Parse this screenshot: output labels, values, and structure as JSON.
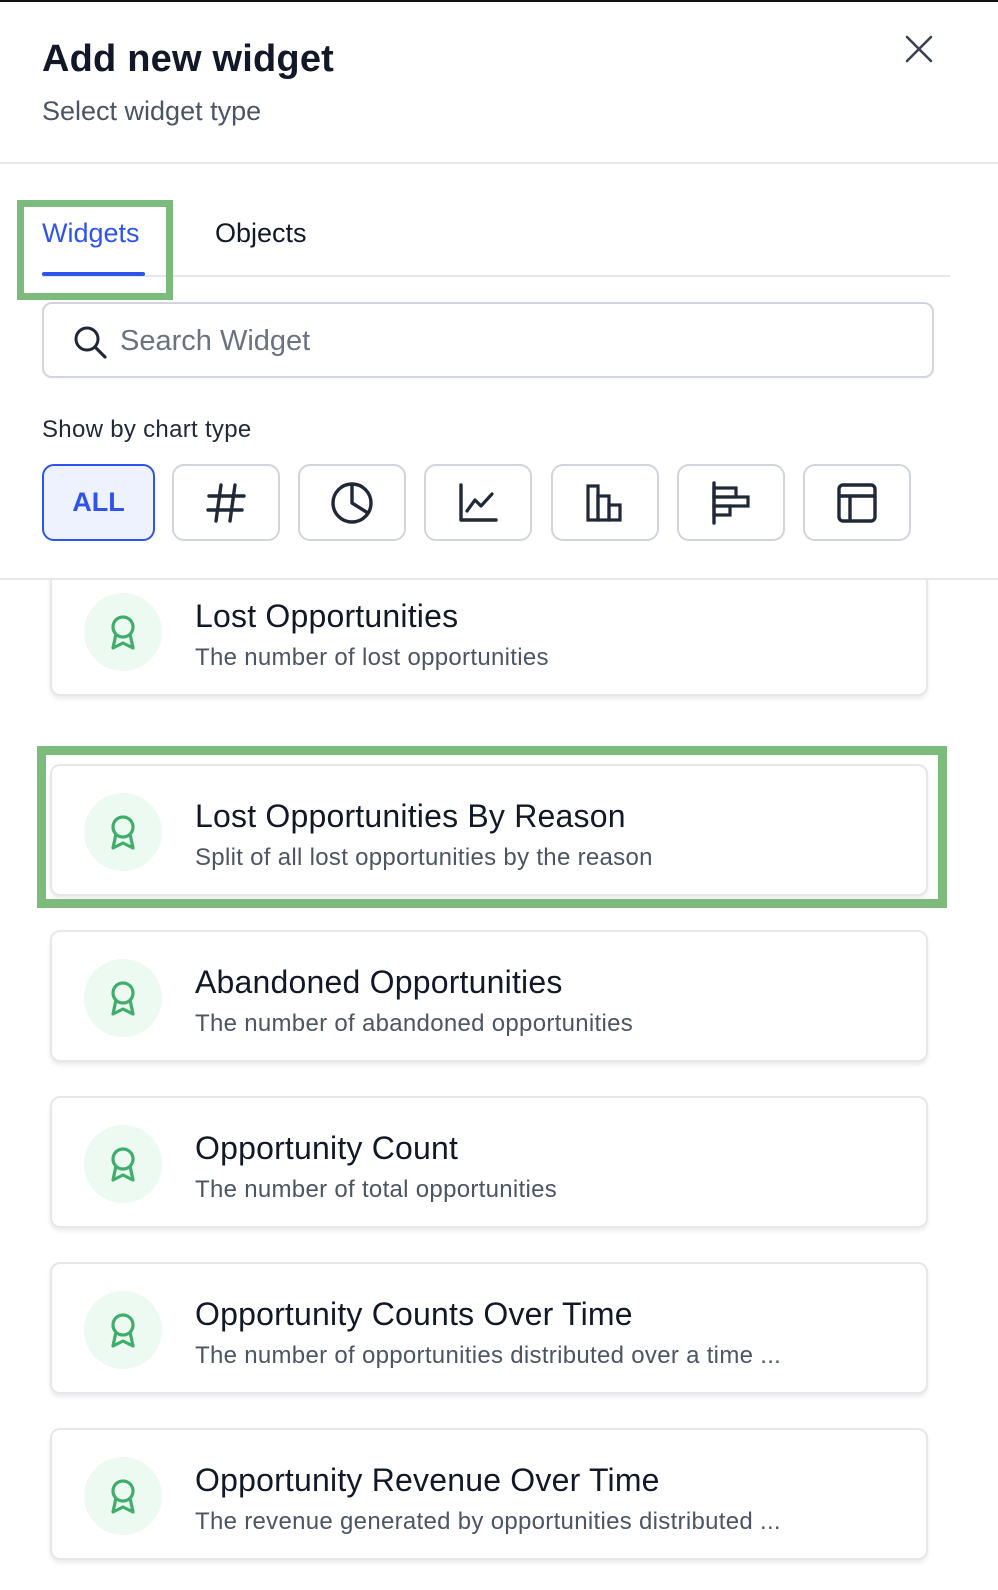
{
  "header": {
    "title": "Add new widget",
    "subtitle": "Select widget type",
    "close_icon": "close-icon"
  },
  "tabs": [
    {
      "label": "Widgets",
      "active": true
    },
    {
      "label": "Objects",
      "active": false
    }
  ],
  "search": {
    "placeholder": "Search Widget",
    "value": "",
    "icon": "search-icon"
  },
  "filter": {
    "label": "Show by chart type",
    "options": [
      {
        "label": "ALL",
        "icon": null,
        "active": true
      },
      {
        "icon": "hash-icon",
        "active": false
      },
      {
        "icon": "pie-chart-icon",
        "active": false
      },
      {
        "icon": "line-chart-icon",
        "active": false
      },
      {
        "icon": "bar-chart-icon",
        "active": false
      },
      {
        "icon": "horizontal-bar-chart-icon",
        "active": false
      },
      {
        "icon": "table-icon",
        "active": false
      }
    ]
  },
  "widgets": [
    {
      "title": "Lost Opportunities",
      "description": "The number of lost opportunities",
      "icon": "award-icon"
    },
    {
      "title": "Lost Opportunities By Reason",
      "description": "Split of all lost opportunities by the reason",
      "icon": "award-icon",
      "highlighted": true
    },
    {
      "title": "Abandoned Opportunities",
      "description": "The number of abandoned opportunities",
      "icon": "award-icon"
    },
    {
      "title": "Opportunity Count",
      "description": "The number of total opportunities",
      "icon": "award-icon"
    },
    {
      "title": "Opportunity Counts Over Time",
      "description": "The number of opportunities distributed over a time ...",
      "icon": "award-icon"
    },
    {
      "title": "Opportunity Revenue Over Time",
      "description": "The revenue generated by opportunities distributed ...",
      "icon": "award-icon"
    }
  ],
  "colors": {
    "accent": "#2f54eb",
    "highlight": "#7dbb7d",
    "icon_green": "#3fae6a",
    "icon_bg": "#ecfaf1"
  }
}
